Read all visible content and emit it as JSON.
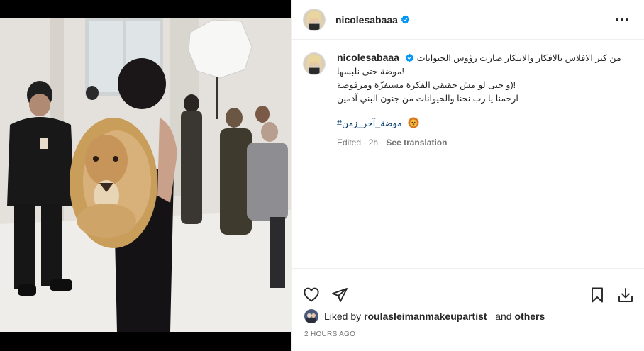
{
  "post": {
    "username": "nicolesabaaa",
    "verified": true,
    "more_icon": "more-horizontal-icon",
    "caption": {
      "line1": "من كتر الافلاس بالافكار والابتكار صارت رؤوس الحيوانات",
      "line2": "!موضة حتى نلبسها",
      "line3": "!(و حتى لو مش حقيقي الفكرة مستفزّة ومرفوضة",
      "line4": "ارحمنا يا رب نحنا والحيوانات من جنون البني آدمين",
      "hashtag": "#موضة_آخر_زمن",
      "emoji": "lion-face-emoji"
    },
    "edited_label": "Edited",
    "age": "2h",
    "see_translation": "See translation",
    "likes": {
      "prefix": "Liked by",
      "user": "roulasleimanmakeupartist_",
      "and": "and",
      "others": "others"
    },
    "timestamp": "2 hours ago"
  },
  "icons": {
    "like": "heart-icon",
    "share": "share-icon",
    "save": "bookmark-icon",
    "download": "download-icon"
  },
  "colors": {
    "verified_blue": "#0095f6",
    "link_blue": "#00376b",
    "secondary_text": "#737373"
  }
}
